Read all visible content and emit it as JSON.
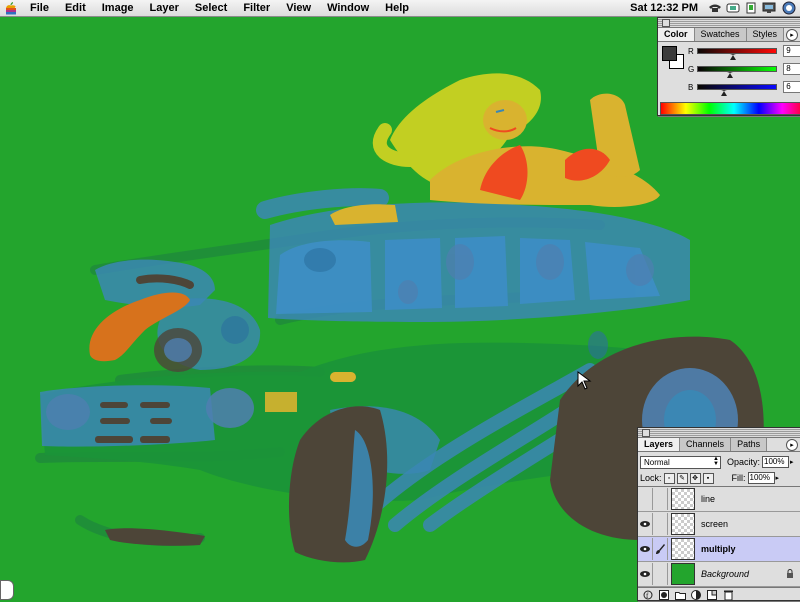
{
  "menubar": {
    "items": [
      "File",
      "Edit",
      "Image",
      "Layer",
      "Select",
      "Filter",
      "View",
      "Window",
      "Help"
    ],
    "clock": "Sat 12:32 PM"
  },
  "color_palette": {
    "tabs": [
      "Color",
      "Swatches",
      "Styles"
    ],
    "channels": [
      {
        "label": "R",
        "value": "9"
      },
      {
        "label": "G",
        "value": "8"
      },
      {
        "label": "B",
        "value": "6"
      }
    ],
    "foreground_color": "#3b3b3b",
    "background_color": "#ffffff"
  },
  "layers_palette": {
    "tabs": [
      "Layers",
      "Channels",
      "Paths"
    ],
    "blend_mode": "Normal",
    "opacity_label": "Opacity:",
    "opacity_value": "100%",
    "lock_label": "Lock:",
    "fill_label": "Fill:",
    "fill_value": "100%",
    "layers": [
      {
        "name": "line",
        "visible": false
      },
      {
        "name": "screen",
        "visible": true
      },
      {
        "name": "multiply",
        "visible": true,
        "selected": true
      },
      {
        "name": "Background",
        "visible": true,
        "locked": true
      }
    ]
  },
  "colors": {
    "canvas": "#23a52d",
    "car_blue": "#3b87b4",
    "tire_brown": "#4d4538",
    "hair_yellow": "#c2cf22",
    "skin": "#d9b32f",
    "bikini": "#ef4a20",
    "exhaust_orange": "#d7721c"
  }
}
